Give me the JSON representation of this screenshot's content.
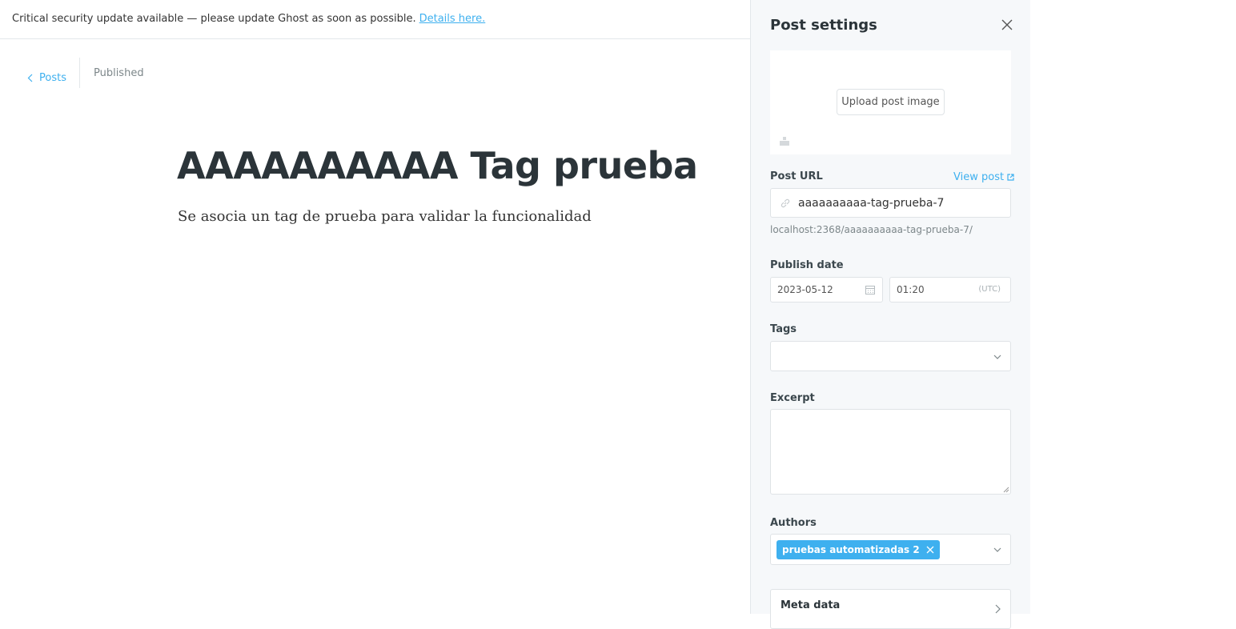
{
  "notice": {
    "message": "Critical security update available — please update Ghost as soon as possible.",
    "link": "Details here."
  },
  "breadcrumb": {
    "back_label": "Posts",
    "status": "Published"
  },
  "editor": {
    "title": "AAAAAAAAAA Tag prueba",
    "body": "Se asocia un tag de prueba para validar la funcionalidad"
  },
  "settings": {
    "title": "Post settings",
    "upload_label": "Upload post image",
    "url_label": "Post URL",
    "view_post": "View post",
    "slug": "aaaaaaaaaa-tag-prueba-7",
    "url_preview": "localhost:2368/aaaaaaaaaa-tag-prueba-7/",
    "publish_label": "Publish date",
    "date": "2023-05-12",
    "time": "01:20",
    "timezone": "(UTC)",
    "tags_label": "Tags",
    "excerpt_label": "Excerpt",
    "authors_label": "Authors",
    "author": "pruebas automatizadas 2",
    "meta_label": "Meta data"
  },
  "colors": {
    "accent": "#3eb0ef",
    "panel_bg": "#f6f8fa",
    "border": "#dfe3e6"
  },
  "icons": [
    "chevron-left-icon",
    "close-icon",
    "image-icon",
    "external-link-icon",
    "link-icon",
    "calendar-icon",
    "chevron-down-icon",
    "chevron-right-icon"
  ]
}
